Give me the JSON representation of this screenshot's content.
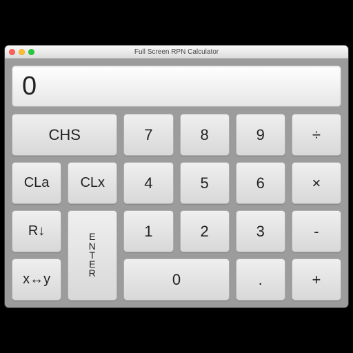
{
  "window": {
    "title": "Full Screen RPN Calculator"
  },
  "display": {
    "value": "0"
  },
  "keys": {
    "chs": "CHS",
    "seven": "7",
    "eight": "8",
    "nine": "9",
    "divide": "÷",
    "cla": "CLa",
    "clx": "CLx",
    "four": "4",
    "five": "5",
    "six": "6",
    "multiply": "×",
    "rdown": "R↓",
    "enter": "ENTER",
    "one": "1",
    "two": "2",
    "three": "3",
    "subtract": "-",
    "xy": "x↔y",
    "zero": "0",
    "dot": ".",
    "add": "+"
  }
}
